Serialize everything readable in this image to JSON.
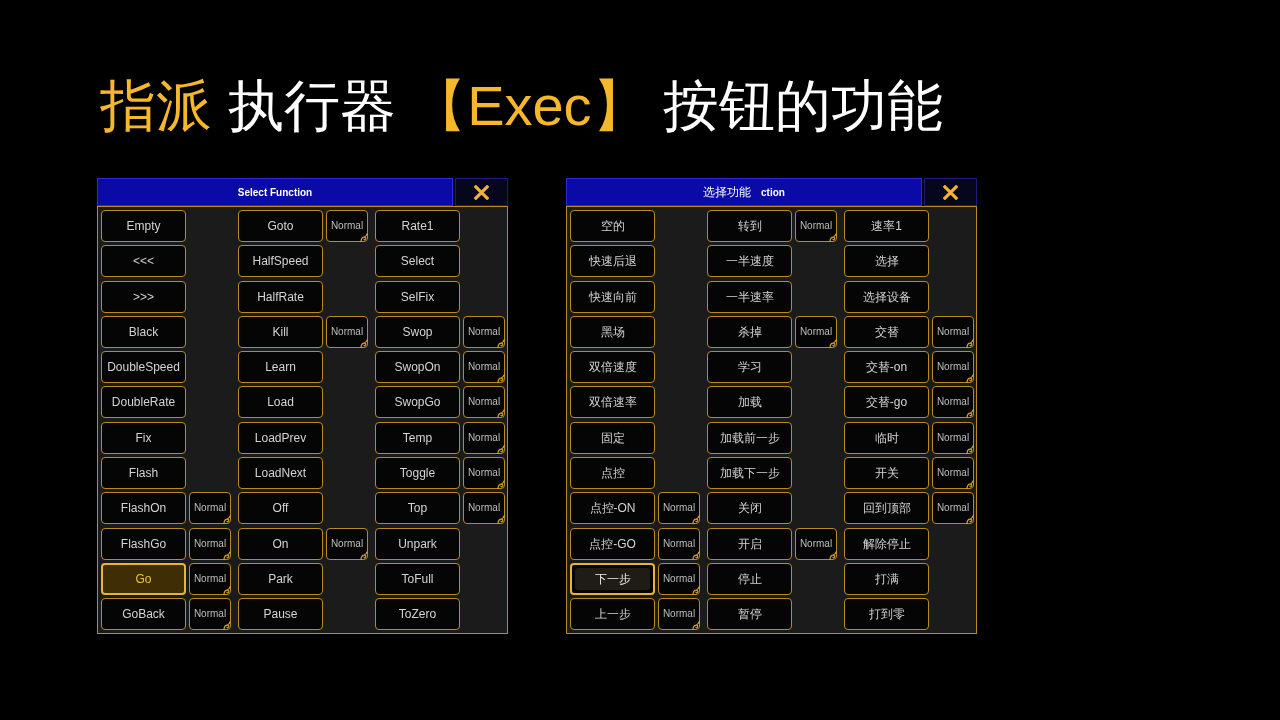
{
  "title": [
    {
      "text": "指派",
      "highlight": true
    },
    {
      "text": "执行器",
      "highlight": false
    },
    {
      "text": "【Exec】",
      "highlight": true
    },
    {
      "text": "按钮的功能",
      "highlight": false
    }
  ],
  "dialogs": [
    {
      "title": "Select Function",
      "rows": [
        {
          "cells": [
            {
              "label": "Empty",
              "selected": false,
              "focused": false
            },
            {
              "label": "Goto",
              "mode": "Normal",
              "selected": false,
              "focused": false
            },
            {
              "label": "Rate1",
              "selected": false,
              "focused": false
            }
          ]
        },
        {
          "cells": [
            {
              "label": "<<<",
              "selected": false,
              "focused": false
            },
            {
              "label": "HalfSpeed",
              "selected": false,
              "focused": false
            },
            {
              "label": "Select",
              "selected": false,
              "focused": false
            }
          ]
        },
        {
          "cells": [
            {
              "label": ">>>",
              "selected": false,
              "focused": false
            },
            {
              "label": "HalfRate",
              "selected": false,
              "focused": false
            },
            {
              "label": "SelFix",
              "selected": false,
              "focused": false
            }
          ]
        },
        {
          "cells": [
            {
              "label": "Black",
              "selected": false,
              "focused": false
            },
            {
              "label": "Kill",
              "mode": "Normal",
              "selected": false,
              "focused": false
            },
            {
              "label": "Swop",
              "mode": "Normal",
              "selected": false,
              "focused": false
            }
          ]
        },
        {
          "cells": [
            {
              "label": "DoubleSpeed",
              "selected": false,
              "focused": false
            },
            {
              "label": "Learn",
              "selected": false,
              "focused": false
            },
            {
              "label": "SwopOn",
              "mode": "Normal",
              "selected": false,
              "focused": false
            }
          ]
        },
        {
          "cells": [
            {
              "label": "DoubleRate",
              "selected": false,
              "focused": false
            },
            {
              "label": "Load",
              "selected": false,
              "focused": false
            },
            {
              "label": "SwopGo",
              "mode": "Normal",
              "selected": false,
              "focused": false
            }
          ]
        },
        {
          "cells": [
            {
              "label": "Fix",
              "selected": false,
              "focused": false
            },
            {
              "label": "LoadPrev",
              "selected": false,
              "focused": false
            },
            {
              "label": "Temp",
              "mode": "Normal",
              "selected": false,
              "focused": false
            }
          ]
        },
        {
          "cells": [
            {
              "label": "Flash",
              "selected": false,
              "focused": false
            },
            {
              "label": "LoadNext",
              "selected": false,
              "focused": false
            },
            {
              "label": "Toggle",
              "mode": "Normal",
              "selected": false,
              "focused": false
            }
          ]
        },
        {
          "cells": [
            {
              "label": "FlashOn",
              "mode": "Normal",
              "selected": false,
              "focused": false
            },
            {
              "label": "Off",
              "selected": false,
              "focused": false
            },
            {
              "label": "Top",
              "mode": "Normal",
              "selected": false,
              "focused": false
            }
          ]
        },
        {
          "cells": [
            {
              "label": "FlashGo",
              "mode": "Normal",
              "selected": false,
              "focused": false
            },
            {
              "label": "On",
              "mode": "Normal",
              "selected": false,
              "focused": false
            },
            {
              "label": "Unpark",
              "selected": false,
              "focused": false
            }
          ]
        },
        {
          "cells": [
            {
              "label": "Go",
              "mode": "Normal",
              "selected": true,
              "focused": false
            },
            {
              "label": "Park",
              "selected": false,
              "focused": false
            },
            {
              "label": "ToFull",
              "selected": false,
              "focused": false
            }
          ]
        },
        {
          "cells": [
            {
              "label": "GoBack",
              "mode": "Normal",
              "selected": false,
              "focused": false
            },
            {
              "label": "Pause",
              "selected": false,
              "focused": false
            },
            {
              "label": "ToZero",
              "selected": false,
              "focused": false
            }
          ]
        }
      ]
    },
    {
      "title": "选择功能",
      "title_fragment": "ction",
      "rows": [
        {
          "cells": [
            {
              "label": "空的",
              "selected": false,
              "focused": false
            },
            {
              "label": "转到",
              "mode": "Normal",
              "selected": false,
              "focused": false
            },
            {
              "label": "速率1",
              "selected": false,
              "focused": false
            }
          ]
        },
        {
          "cells": [
            {
              "label": "快速后退",
              "selected": false,
              "focused": false
            },
            {
              "label": "一半速度",
              "selected": false,
              "focused": false
            },
            {
              "label": "选择",
              "selected": false,
              "focused": false
            }
          ]
        },
        {
          "cells": [
            {
              "label": "快速向前",
              "selected": false,
              "focused": false
            },
            {
              "label": "一半速率",
              "selected": false,
              "focused": false
            },
            {
              "label": "选择设备",
              "selected": false,
              "focused": false
            }
          ]
        },
        {
          "cells": [
            {
              "label": "黑场",
              "selected": false,
              "focused": false
            },
            {
              "label": "杀掉",
              "mode": "Normal",
              "selected": false,
              "focused": false
            },
            {
              "label": "交替",
              "mode": "Normal",
              "selected": false,
              "focused": false
            }
          ]
        },
        {
          "cells": [
            {
              "label": "双倍速度",
              "selected": false,
              "focused": false
            },
            {
              "label": "学习",
              "selected": false,
              "focused": false
            },
            {
              "label": "交替-on",
              "mode": "Normal",
              "selected": false,
              "focused": false
            }
          ]
        },
        {
          "cells": [
            {
              "label": "双倍速率",
              "selected": false,
              "focused": false
            },
            {
              "label": "加载",
              "selected": false,
              "focused": false
            },
            {
              "label": "交替-go",
              "mode": "Normal",
              "selected": false,
              "focused": false
            }
          ]
        },
        {
          "cells": [
            {
              "label": "固定",
              "selected": false,
              "focused": false
            },
            {
              "label": "加载前一步",
              "selected": false,
              "focused": false
            },
            {
              "label": "临时",
              "mode": "Normal",
              "selected": false,
              "focused": false
            }
          ]
        },
        {
          "cells": [
            {
              "label": "点控",
              "selected": false,
              "focused": false
            },
            {
              "label": "加载下一步",
              "selected": false,
              "focused": false
            },
            {
              "label": "开关",
              "mode": "Normal",
              "selected": false,
              "focused": false
            }
          ]
        },
        {
          "cells": [
            {
              "label": "点控-ON",
              "mode": "Normal",
              "selected": false,
              "focused": false
            },
            {
              "label": "关闭",
              "selected": false,
              "focused": false
            },
            {
              "label": "回到顶部",
              "mode": "Normal",
              "selected": false,
              "focused": false
            }
          ]
        },
        {
          "cells": [
            {
              "label": "点控-GO",
              "mode": "Normal",
              "selected": false,
              "focused": false
            },
            {
              "label": "开启",
              "mode": "Normal",
              "selected": false,
              "focused": false
            },
            {
              "label": "解除停止",
              "selected": false,
              "focused": false
            }
          ]
        },
        {
          "cells": [
            {
              "label": "下一步",
              "mode": "Normal",
              "selected": false,
              "focused": true
            },
            {
              "label": "停止",
              "selected": false,
              "focused": false
            },
            {
              "label": "打满",
              "selected": false,
              "focused": false
            }
          ]
        },
        {
          "cells": [
            {
              "label": "上一步",
              "mode": "Normal",
              "selected": false,
              "focused": false
            },
            {
              "label": "暂停",
              "selected": false,
              "focused": false
            },
            {
              "label": "打到零",
              "selected": false,
              "focused": false
            }
          ]
        }
      ]
    }
  ]
}
